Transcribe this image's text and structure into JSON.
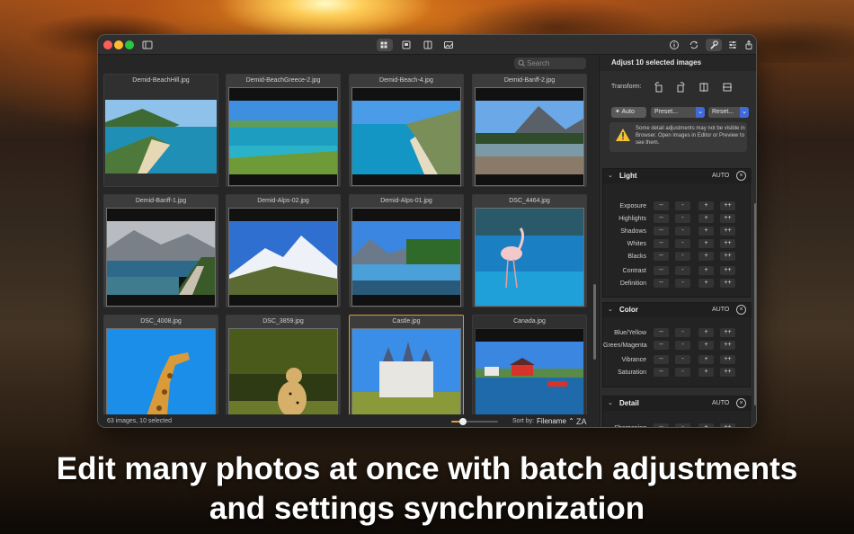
{
  "caption": {
    "line1": "Edit many photos at once with batch adjustments",
    "line2": "and settings synchronization"
  },
  "toolbar": {
    "icons": [
      "sidebar-icon",
      "grid-view-icon",
      "single-view-icon",
      "split-view-icon",
      "photo-view-icon",
      "info-icon",
      "sync-icon",
      "wrench-icon",
      "adjustments-icon",
      "share-icon"
    ]
  },
  "browser": {
    "search_placeholder": "Search",
    "thumbnails": [
      {
        "name": "Demid-BeachHill.jpg"
      },
      {
        "name": "Demid-BeachGreece-2.jpg"
      },
      {
        "name": "Demid-Beach-4.jpg"
      },
      {
        "name": "Demid-Banff-2.jpg"
      },
      {
        "name": "Demid-Banff-1.jpg"
      },
      {
        "name": "Demid-Alps-02.jpg"
      },
      {
        "name": "Demid-Alps-01.jpg"
      },
      {
        "name": "DSC_4464.jpg"
      },
      {
        "name": "DSC_4008.jpg"
      },
      {
        "name": "DSC_3859.jpg"
      },
      {
        "name": "Castle.jpg"
      },
      {
        "name": "Canada.jpg"
      }
    ],
    "status": "63 images, 10 selected",
    "zoom_level": 0.25,
    "sort_label": "Sort by:",
    "sort_value": "Filename",
    "sort_order_glyph": "ZA"
  },
  "inspector": {
    "title": "Adjust 10 selected images",
    "transform_label": "Transform:",
    "auto_label": "Auto",
    "preset_label": "Preset...",
    "reset_label": "Reset...",
    "warning": "Some detail adjustments may not be visible in  Browser. Open images in Editor or Preview to see them.",
    "sections": [
      {
        "title": "Light",
        "auto": "AUTO",
        "rows": [
          "Exposure",
          "Highlights",
          "Shadows",
          "Whites",
          "Blacks",
          "Contrast",
          "Definition"
        ]
      },
      {
        "title": "Color",
        "auto": "AUTO",
        "rows": [
          "Blue/Yellow",
          "Green/Magenta",
          "Vibrance",
          "Saturation"
        ]
      },
      {
        "title": "Detail",
        "auto": "AUTO",
        "rows": [
          "Sharpening"
        ]
      }
    ],
    "steppers": [
      "--",
      "-",
      "+",
      "++"
    ],
    "close_glyph": "×",
    "chevron_glyph": "❯"
  }
}
